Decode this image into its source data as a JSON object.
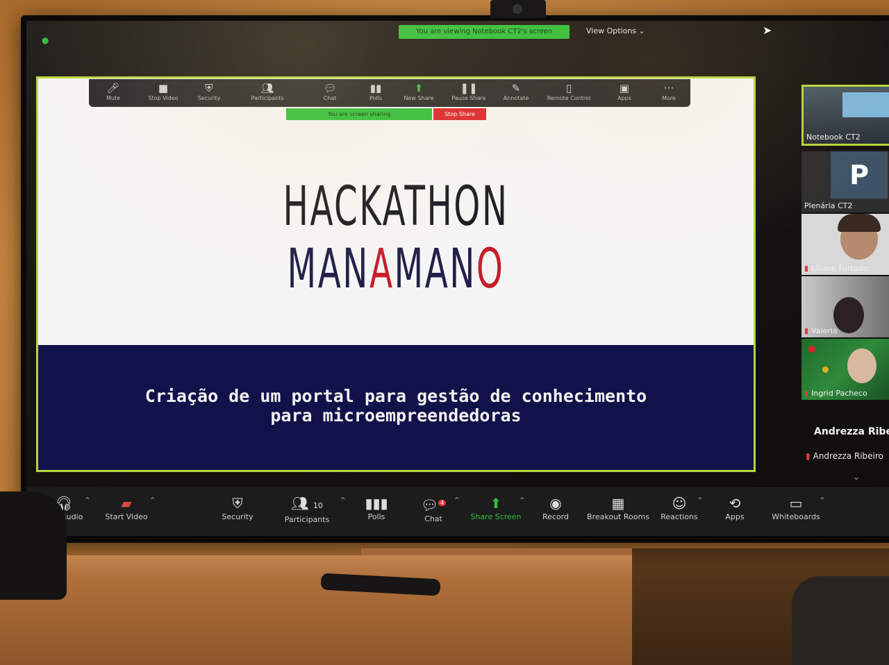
{
  "zoom": {
    "top_bar": {
      "viewing_banner": "You are viewing Notebook CT2's screen",
      "view_options": "View Options ⌄"
    },
    "shared_slide": {
      "title_part1": "HACKATHON ",
      "title_part2": "MAN",
      "title_part3": "A",
      "title_part4": "MAN",
      "title_part5": "O",
      "subtitle_line1": "Criação de um portal para gestão de conhecimento",
      "subtitle_line2": "para microempreendedoras",
      "colors": {
        "border": "#b7d63a",
        "bottom_band": "#12124a",
        "accent_red": "#c61d2a"
      }
    },
    "mini_toolbar": {
      "items": [
        {
          "label": "Mute",
          "icon": "microphone-icon"
        },
        {
          "label": "Stop Video",
          "icon": "camera-icon"
        },
        {
          "label": "Security",
          "icon": "shield-icon"
        },
        {
          "label": "Participants",
          "icon": "people-icon"
        },
        {
          "label": "Chat",
          "icon": "chat-icon"
        },
        {
          "label": "Polls",
          "icon": "bar-chart-icon"
        },
        {
          "label": "New Share",
          "icon": "share-up-icon"
        },
        {
          "label": "Pause Share",
          "icon": "pause-icon"
        },
        {
          "label": "Annotate",
          "icon": "pen-icon"
        },
        {
          "label": "Remote Control",
          "icon": "mouse-icon"
        },
        {
          "label": "Apps",
          "icon": "apps-icon"
        },
        {
          "label": "More",
          "icon": "more-dots-icon"
        }
      ],
      "sharing_label": "You are screen sharing",
      "stop_share_label": "Stop Share"
    },
    "gallery": {
      "tiles": [
        {
          "name": "Notebook CT2"
        },
        {
          "name": "Plenária CT2",
          "avatar_letter": "P"
        },
        {
          "name": "Liliane Furtado"
        },
        {
          "name": "Valeria"
        },
        {
          "name": "Ingrid Pacheco"
        }
      ],
      "extra_name_bold": "Andrezza Ribei",
      "extra_name": "Andrezza Ribeiro"
    },
    "toolbar": {
      "items": [
        {
          "label": "Join Audio",
          "icon": "headphones-icon"
        },
        {
          "label": "Start Video",
          "icon": "camera-off-icon"
        },
        {
          "label": "Security",
          "icon": "shield-icon"
        },
        {
          "label": "Participants",
          "icon": "people-icon",
          "count": "10"
        },
        {
          "label": "Polls",
          "icon": "bar-chart-icon"
        },
        {
          "label": "Chat",
          "icon": "chat-icon",
          "badge": "4"
        },
        {
          "label": "Share Screen",
          "icon": "share-up-icon"
        },
        {
          "label": "Record",
          "icon": "record-icon"
        },
        {
          "label": "Breakout Rooms",
          "icon": "grid-icon"
        },
        {
          "label": "Reactions",
          "icon": "smiley-icon"
        },
        {
          "label": "Apps",
          "icon": "apps-icon"
        },
        {
          "label": "Whiteboards",
          "icon": "whiteboard-icon"
        }
      ]
    }
  }
}
